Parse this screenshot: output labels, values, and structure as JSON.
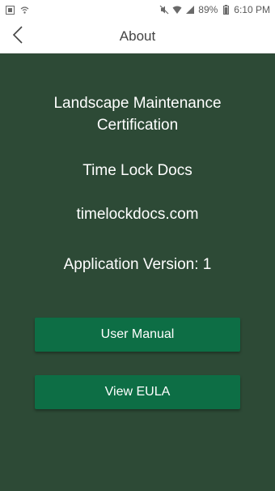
{
  "status_bar": {
    "battery": "89%",
    "time": "6:10 PM",
    "icons": [
      "gallery-icon",
      "wifi-call-icon",
      "mute-icon",
      "wifi-icon",
      "signal-icon",
      "battery-icon"
    ]
  },
  "header": {
    "title": "About"
  },
  "about": {
    "app_name": "Landscape Maintenance Certification",
    "company": "Time Lock Docs",
    "website": "timelockdocs.com",
    "version": "Application Version: 1"
  },
  "buttons": {
    "user_manual": "User Manual",
    "view_eula": "View EULA"
  },
  "colors": {
    "background": "#2d4a36",
    "button": "#0d6e45",
    "header": "#ffffff"
  }
}
